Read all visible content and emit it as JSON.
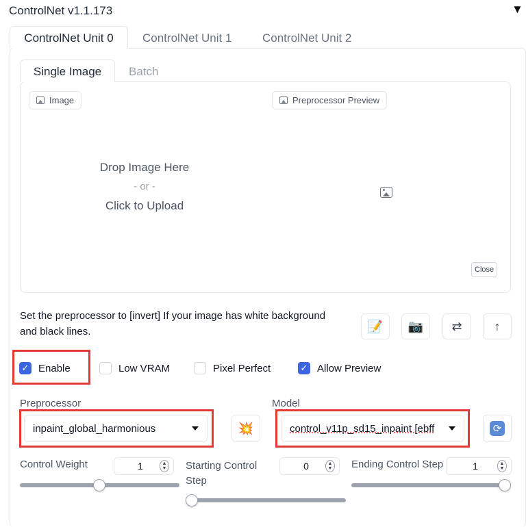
{
  "header": {
    "title": "ControlNet v1.1.173"
  },
  "tabs": [
    {
      "label": "ControlNet Unit 0",
      "active": true
    },
    {
      "label": "ControlNet Unit 1",
      "active": false
    },
    {
      "label": "ControlNet Unit 2",
      "active": false
    }
  ],
  "subtabs": [
    {
      "label": "Single Image",
      "active": true
    },
    {
      "label": "Batch",
      "active": false
    }
  ],
  "image_panel": {
    "image_label": "Image",
    "preview_label": "Preprocessor Preview",
    "drop_text": "Drop Image Here",
    "or_text": "- or -",
    "upload_text": "Click to Upload",
    "close_label": "Close"
  },
  "hint": "Set the preprocessor to [invert] If your image has white background and black lines.",
  "tools": [
    "notepad-icon",
    "camera-icon",
    "swap-arrows-icon",
    "up-arrow-icon"
  ],
  "checkboxes": {
    "enable": {
      "label": "Enable",
      "checked": true
    },
    "low_vram": {
      "label": "Low VRAM",
      "checked": false
    },
    "pixel_perfect": {
      "label": "Pixel Perfect",
      "checked": false
    },
    "allow_preview": {
      "label": "Allow Preview",
      "checked": true
    }
  },
  "preprocessor": {
    "label": "Preprocessor",
    "value": "inpaint_global_harmonious"
  },
  "model": {
    "label": "Model",
    "value": "control_v11p_sd15_inpaint [ebff"
  },
  "sliders": {
    "control_weight": {
      "label": "Control Weight",
      "value": "1"
    },
    "starting_step": {
      "label": "Starting Control Step",
      "value": "0"
    },
    "ending_step": {
      "label": "Ending Control Step",
      "value": "1"
    }
  },
  "colors": {
    "accent": "#3b66e0",
    "highlight": "#e53935"
  }
}
